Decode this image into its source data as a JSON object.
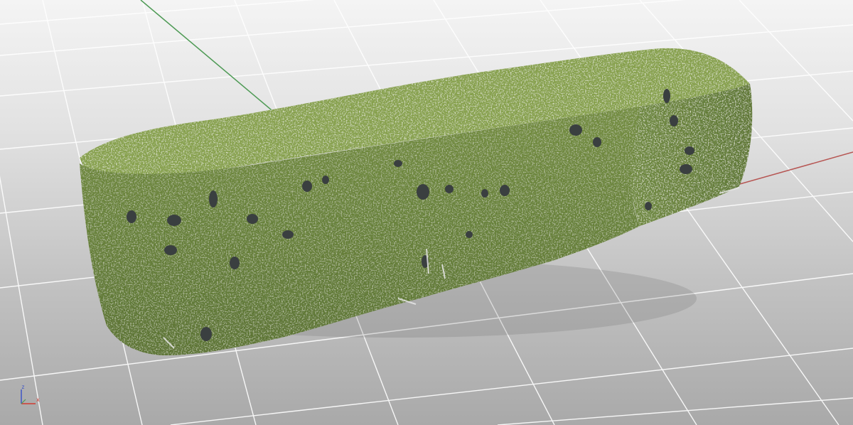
{
  "viewport": {
    "type": "3d-perspective-viewport",
    "subject": "hedge-model",
    "colors": {
      "background_top": "#f4f4f4",
      "background_bottom": "#a9a9a9",
      "grid_line": "#ffffff",
      "x_axis": "#b65552",
      "y_axis": "#4e9a55",
      "foliage_dark": "#4b6226",
      "foliage_mid": "#6f8a3c",
      "foliage_light": "#c9d7a5",
      "shadow_gap": "#3a3f40"
    }
  },
  "axis_gizmo": {
    "z_label": "z",
    "x_label": "x",
    "z_color": "#3f56c6",
    "x_color": "#d23b33"
  }
}
